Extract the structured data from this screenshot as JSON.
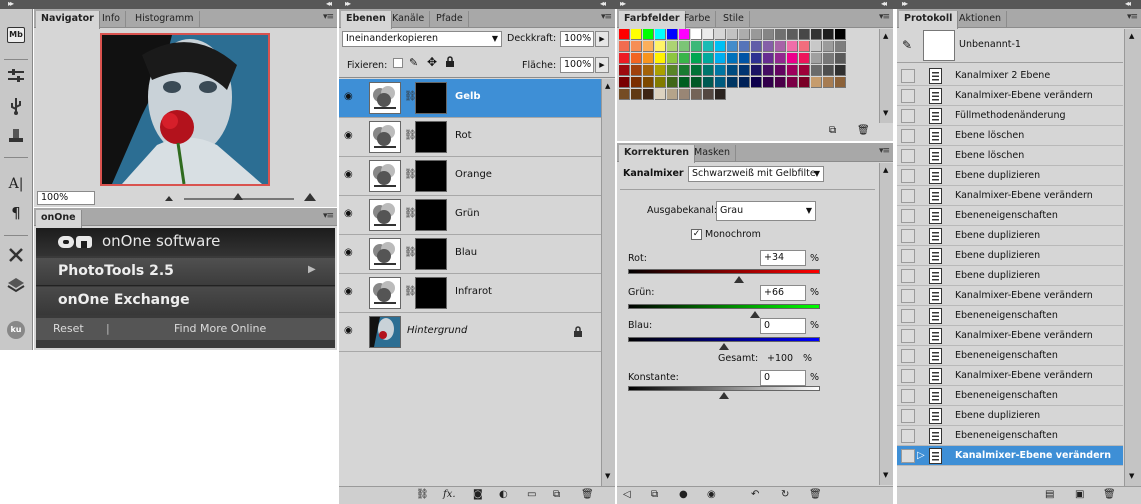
{
  "navigator": {
    "tabs": [
      "Navigator",
      "Info",
      "Histogramm"
    ],
    "zoom": "100%"
  },
  "onone": {
    "tab": "onOne",
    "logo_text": "onOne software",
    "items": [
      "PhotoTools 2.5",
      "onOne Exchange"
    ],
    "reset": "Reset",
    "separator": "|",
    "find_more": "Find More Online"
  },
  "toolbar": {
    "icons": [
      "mb-icon",
      "sliders-icon",
      "usb-icon",
      "stamp-icon",
      "text-tool-icon",
      "paragraph-icon",
      "tools-icon",
      "layers-3d-icon",
      "kuler-icon"
    ],
    "mb_label": "Mb",
    "text_glyph": "A|",
    "para_glyph": "¶",
    "ku_label": "ku"
  },
  "layers": {
    "tabs": [
      "Ebenen",
      "Kanäle",
      "Pfade"
    ],
    "blend_mode": "Ineinanderkopieren",
    "opacity_label": "Deckkraft:",
    "opacity_value": "100%",
    "lock_label": "Fixieren:",
    "fill_label": "Fläche:",
    "fill_value": "100%",
    "rows": [
      {
        "name": "Gelb",
        "selected": true
      },
      {
        "name": "Rot",
        "selected": false
      },
      {
        "name": "Orange",
        "selected": false
      },
      {
        "name": "Grün",
        "selected": false
      },
      {
        "name": "Blau",
        "selected": false
      },
      {
        "name": "Infrarot",
        "selected": false
      }
    ],
    "background_name": "Hintergrund"
  },
  "swatches": {
    "tabs": [
      "Farbfelder",
      "Farbe",
      "Stile"
    ],
    "colors": [
      "#ff0000",
      "#ffff00",
      "#00ff00",
      "#00ffff",
      "#0000ff",
      "#ff00ff",
      "#ffffff",
      "#ebebeb",
      "#d6d6d6",
      "#c2c2c2",
      "#adadad",
      "#999999",
      "#858585",
      "#707070",
      "#5c5c5c",
      "#474747",
      "#333333",
      "#1f1f1f",
      "#000000",
      "#f26c4f",
      "#f68e55",
      "#fbaf5c",
      "#fff467",
      "#acd372",
      "#7cc576",
      "#3bb878",
      "#1abbb4",
      "#00bff3",
      "#438ccb",
      "#5574b9",
      "#605ca8",
      "#855fa8",
      "#a763a8",
      "#f06ea9",
      "#f26d7d",
      "#c8c8c8",
      "#9b9b9b",
      "#7d7d7d",
      "#ed1c24",
      "#f26522",
      "#f7941d",
      "#fff200",
      "#8dc63f",
      "#39b54a",
      "#00a651",
      "#00a99d",
      "#00aeef",
      "#0072bc",
      "#0054a6",
      "#2e3192",
      "#662d91",
      "#92278f",
      "#ec008c",
      "#ed145b",
      "#a0a0a0",
      "#787878",
      "#5a5a5a",
      "#9e0b0f",
      "#a0410d",
      "#a36209",
      "#aba000",
      "#598527",
      "#197b30",
      "#007236",
      "#00746b",
      "#0076a3",
      "#004b80",
      "#003471",
      "#1b1464",
      "#440e62",
      "#630460",
      "#9e005d",
      "#9e0039",
      "#6a6a6a",
      "#4e4e4e",
      "#303030",
      "#790000",
      "#7b2e00",
      "#7d4900",
      "#827b00",
      "#406618",
      "#005e20",
      "#005826",
      "#005952",
      "#005b7f",
      "#003663",
      "#002157",
      "#0d004c",
      "#32004b",
      "#4b0049",
      "#7b0046",
      "#7a0026",
      "#c69c6d",
      "#a67c52",
      "#8c6239",
      "#754c24",
      "#603913",
      "#3c2415",
      "#ddd2c0",
      "#b5a48a",
      "#998675",
      "#736357",
      "#534741",
      "#2a2320"
    ]
  },
  "adjust": {
    "tabs": [
      "Korrekturen",
      "Masken"
    ],
    "title": "Kanalmixer",
    "preset": "Schwarzweiß mit Gelbfilte",
    "output_label": "Ausgabekanal:",
    "output_value": "Grau",
    "mono_label": "Monochrom",
    "sliders": [
      {
        "label": "Rot:",
        "value": "+34",
        "unit": "%",
        "pos": 0.58
      },
      {
        "label": "Grün:",
        "value": "+66",
        "unit": "%",
        "pos": 0.66
      },
      {
        "label": "Blau:",
        "value": "0",
        "unit": "%",
        "pos": 0.5
      }
    ],
    "total_label": "Gesamt:",
    "total_value": "+100",
    "total_unit": "%",
    "constant": {
      "label": "Konstante:",
      "value": "0",
      "unit": "%",
      "pos": 0.5
    }
  },
  "history": {
    "tabs": [
      "Protokoll",
      "Aktionen"
    ],
    "snapshot": "Unbenannt-1",
    "rows": [
      "Kanalmixer 2 Ebene",
      "Kanalmixer-Ebene verändern",
      "Füllmethodenänderung",
      "Ebene löschen",
      "Ebene löschen",
      "Ebene duplizieren",
      "Kanalmixer-Ebene verändern",
      "Ebeneneigenschaften",
      "Ebene duplizieren",
      "Ebene duplizieren",
      "Ebene duplizieren",
      "Kanalmixer-Ebene verändern",
      "Ebeneneigenschaften",
      "Kanalmixer-Ebene verändern",
      "Ebeneneigenschaften",
      "Kanalmixer-Ebene verändern",
      "Ebeneneigenschaften",
      "Ebene duplizieren",
      "Ebeneneigenschaften",
      "Kanalmixer-Ebene verändern"
    ],
    "selected_index": 19
  }
}
